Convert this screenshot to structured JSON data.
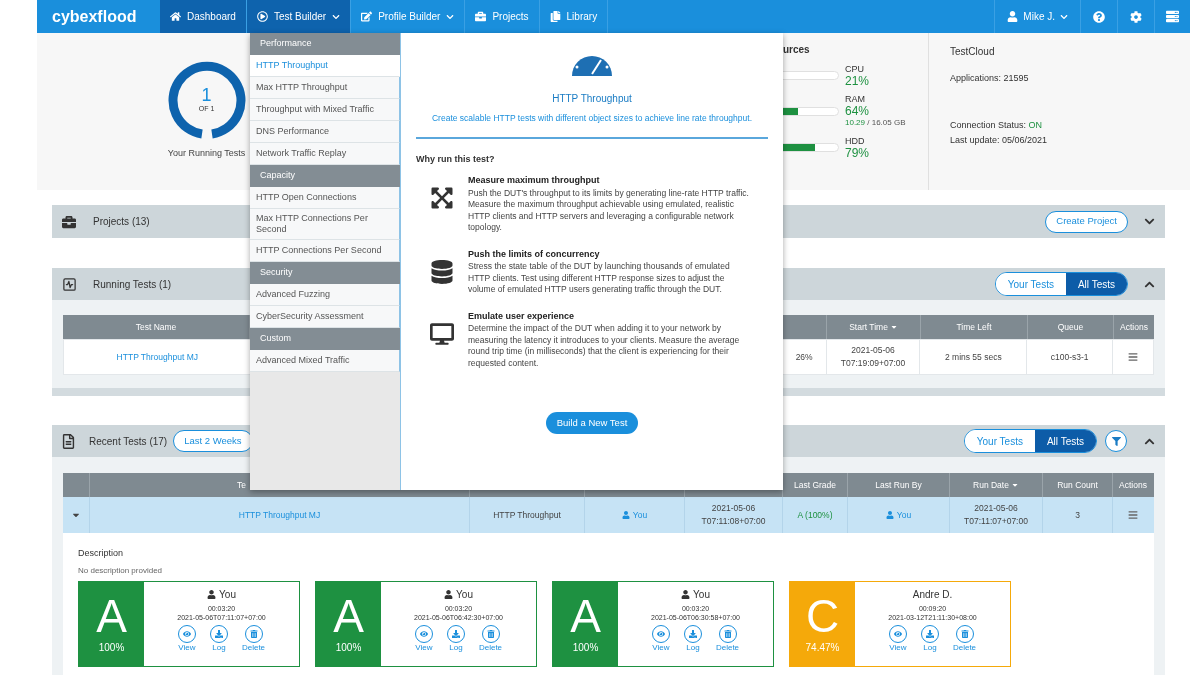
{
  "nav": {
    "logo": "cybexflood",
    "user": "Mike J.",
    "items": [
      {
        "label": "Dashboard",
        "selected": true,
        "dropdown": false
      },
      {
        "label": "Test Builder",
        "selected": true,
        "dropdown": true
      },
      {
        "label": "Profile Builder",
        "selected": false,
        "dropdown": true
      },
      {
        "label": "Projects",
        "selected": false,
        "dropdown": false
      },
      {
        "label": "Library",
        "selected": false,
        "dropdown": false
      }
    ]
  },
  "running_summary": {
    "count": "1",
    "of": "OF 1",
    "label": "Your Running Tests"
  },
  "resources": {
    "title": "urces",
    "meters": [
      {
        "name": "CPU",
        "reading": "21%"
      },
      {
        "name": "RAM",
        "reading": "64%",
        "level": 0.64,
        "used": "10.29",
        "total": " / 16.05 GB"
      },
      {
        "name": "HDD",
        "reading": "79%",
        "level": 0.79
      }
    ]
  },
  "testcloud": {
    "title": "TestCloud",
    "applications": "Applications: 21595",
    "status_label": "Connection Status:",
    "status": "ON",
    "last_update": "Last update: 05/06/2021"
  },
  "projects": {
    "title": "Projects (13)",
    "button": "Create Project",
    "expanded": false
  },
  "running_tests": {
    "title": "Running Tests (1)",
    "expanded": true,
    "toggle": [
      {
        "label": "Your Tests",
        "selected": false
      },
      {
        "label": "All Tests",
        "selected": true
      }
    ],
    "columns": {
      "test_name": {
        "label": "Test Name",
        "sorted": false
      },
      "start_time": {
        "label": "Start Time",
        "sorted": true
      },
      "time_left": {
        "label": "Time Left",
        "sorted": false
      },
      "queue": {
        "label": "Queue",
        "sorted": false
      },
      "actions": {
        "label": "Actions",
        "sorted": false
      }
    },
    "rows": [
      {
        "test_name": "HTTP Throughput MJ",
        "column_3": "26%",
        "start_time": [
          "2021-05-06",
          "T07:19:09+07:00"
        ],
        "time_left": "2 mins 55 secs",
        "queue": "c100-s3-1"
      }
    ]
  },
  "recent_tests": {
    "title": "Recent Tests (17)",
    "period": "Last 2 Weeks",
    "expanded": true,
    "toggle": [
      {
        "label": "Your Tests",
        "selected": false
      },
      {
        "label": "All Tests",
        "selected": true
      }
    ],
    "columns": {
      "column_2": {
        "label": "Te",
        "sorted": false
      },
      "last_grade": {
        "label": "Last Grade",
        "sorted": false
      },
      "last_run_by": {
        "label": "Last Run By",
        "sorted": false
      },
      "run_date": {
        "label": "Run Date",
        "sorted": true
      },
      "run_count": {
        "label": "Run Count",
        "sorted": false
      },
      "actions": {
        "label": "Actions",
        "sorted": false
      }
    },
    "rows": [
      {
        "expanded": true,
        "test_name": "HTTP Throughput MJ",
        "type": "HTTP Throughput",
        "owner": "You",
        "created": [
          "2021-05-06",
          "T07:11:08+07:00"
        ],
        "last_grade": "A (100%)",
        "last_run_by": "You",
        "run_date": [
          "2021-05-06",
          "T07:11:07+07:00"
        ],
        "run_count": "3",
        "description_label": "Description",
        "description": "No description provided",
        "runs": [
          {
            "grade": "A",
            "score": "100%",
            "color": "#1e9141",
            "user": "You",
            "user_icon": true,
            "duration": "00:03:20",
            "date": "2021-05-06T07:11:07+07:00",
            "actions": [
              "View",
              "Log",
              "Delete"
            ]
          },
          {
            "grade": "A",
            "score": "100%",
            "color": "#1e9141",
            "user": "You",
            "user_icon": true,
            "duration": "00:03:20",
            "date": "2021-05-06T06:42:30+07:00",
            "actions": [
              "View",
              "Log",
              "Delete"
            ]
          },
          {
            "grade": "A",
            "score": "100%",
            "color": "#1e9141",
            "user": "You",
            "user_icon": true,
            "duration": "00:03:20",
            "date": "2021-05-06T06:30:58+07:00",
            "actions": [
              "View",
              "Log",
              "Delete"
            ]
          },
          {
            "grade": "C",
            "score": "74.47%",
            "color": "#f5a90a",
            "user": "Andre D.",
            "user_icon": false,
            "duration": "00:09:20",
            "date": "2021-03-12T21:11:30+08:00",
            "actions": [
              "View",
              "Log",
              "Delete"
            ]
          }
        ]
      }
    ]
  },
  "menu": {
    "groups": [
      {
        "label": "Performance",
        "items": [
          {
            "label": "HTTP Throughput",
            "selected": true
          },
          {
            "label": "Max HTTP Throughput",
            "selected": false
          },
          {
            "label": "Throughput with Mixed Traffic",
            "selected": false
          },
          {
            "label": "DNS Performance",
            "selected": false
          },
          {
            "label": "Network Traffic Replay",
            "selected": false
          }
        ]
      },
      {
        "label": "Capacity",
        "items": [
          {
            "label": "HTTP Open Connections",
            "selected": false
          },
          {
            "label": "Max HTTP Connections Per Second",
            "selected": false
          },
          {
            "label": "HTTP Connections Per Second",
            "selected": false
          }
        ]
      },
      {
        "label": "Security",
        "items": [
          {
            "label": "Advanced Fuzzing",
            "selected": false
          },
          {
            "label": "CyberSecurity Assessment",
            "selected": false
          }
        ]
      },
      {
        "label": "Custom",
        "items": [
          {
            "label": "Advanced Mixed Traffic",
            "selected": false
          }
        ]
      }
    ]
  },
  "detail": {
    "title": "HTTP Throughput",
    "subtitle": "Create scalable HTTP tests with different object sizes to achieve line rate throughput.",
    "why": "Why run this test?",
    "reasons": [
      {
        "title": "Measure maximum throughput",
        "text": "Push the DUT's throughput to its limits by generating line-rate HTTP traffic. Measure the maximum throughput achievable using emulated, realistic HTTP clients and HTTP servers and leveraging a configurable network topology."
      },
      {
        "title": "Push the limits of concurrency",
        "text": "Stress the state table of the DUT by launching thousands of emulated HTTP clients. Test using different HTTP response sizes to adjust the volume of emulated HTTP users generating traffic through the DUT."
      },
      {
        "title": "Emulate user experience",
        "text": "Determine the impact of the DUT when adding it to your network by measuring the latency it introduces to your clients. Measure the average round trip time (in milliseconds) that the client is experiencing for their requested content."
      }
    ],
    "button": "Build a New Test"
  }
}
